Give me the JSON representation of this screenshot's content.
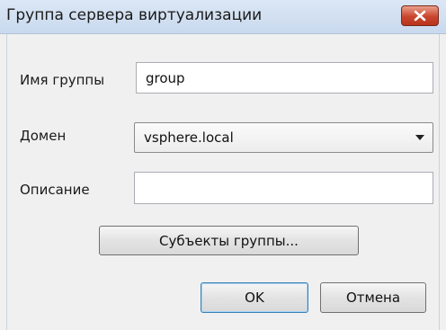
{
  "window": {
    "title": "Группа сервера виртуализации",
    "close_icon": "close-icon"
  },
  "form": {
    "group_name_label": "Имя группы",
    "group_name_value": "group",
    "domain_label": "Домен",
    "domain_selected": "vsphere.local",
    "description_label": "Описание",
    "description_value": ""
  },
  "buttons": {
    "members": "Субъекты группы...",
    "ok": "OK",
    "cancel": "Отмена"
  },
  "colors": {
    "titlebar": "#c9d9ee",
    "close_button": "#c9452d",
    "window_bg": "#f0f0f0",
    "default_button_border": "#3c7fb1"
  }
}
